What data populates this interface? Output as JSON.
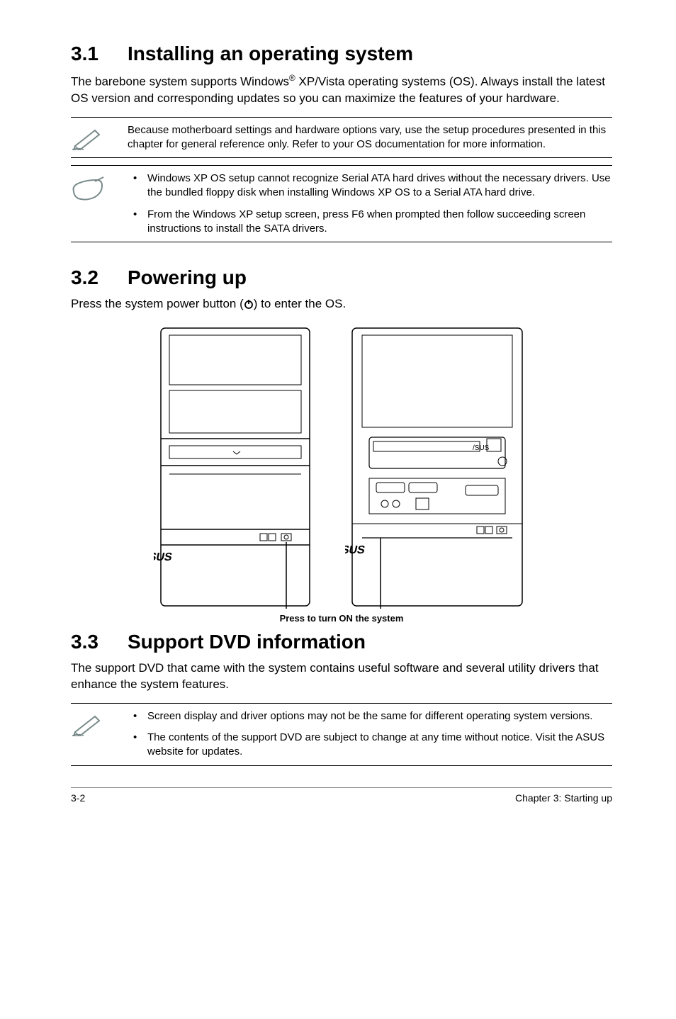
{
  "sections": {
    "s1": {
      "num": "3.1",
      "title": "Installing an operating system"
    },
    "s2": {
      "num": "3.2",
      "title": "Powering up"
    },
    "s3": {
      "num": "3.3",
      "title": "Support DVD information"
    }
  },
  "body": {
    "s1_p1a": "The barebone system supports Windows",
    "s1_p1_reg": "®",
    "s1_p1b": " XP/Vista operating systems (OS). Always install the latest OS version and corresponding updates so you can maximize the features of your hardware.",
    "s2_p1a": "Press the system power button (",
    "s2_p1b": ") to enter the OS.",
    "s3_p1": "The support DVD that came with the system contains useful software and several utility drivers that enhance the system features."
  },
  "notes": {
    "n1": "Because motherboard settings and hardware options vary, use the setup procedures presented in this chapter for general reference only. Refer to your OS documentation for more information.",
    "n2a": "Windows XP OS setup cannot recognize Serial ATA hard drives without the necessary drivers. Use the bundled floppy disk when installing Windows XP OS to a Serial ATA hard drive.",
    "n2b": "From the Windows XP setup screen, press F6 when prompted then follow succeeding screen instructions to install the SATA drivers.",
    "n3a": "Screen display and driver options may not be the same for different operating system versions.",
    "n3b": "The contents of the support DVD are subject to change at any time without notice. Visit the ASUS website for updates."
  },
  "figure": {
    "caption": "Press to turn ON the system"
  },
  "footer": {
    "left": "3-2",
    "right": "Chapter 3: Starting up"
  }
}
